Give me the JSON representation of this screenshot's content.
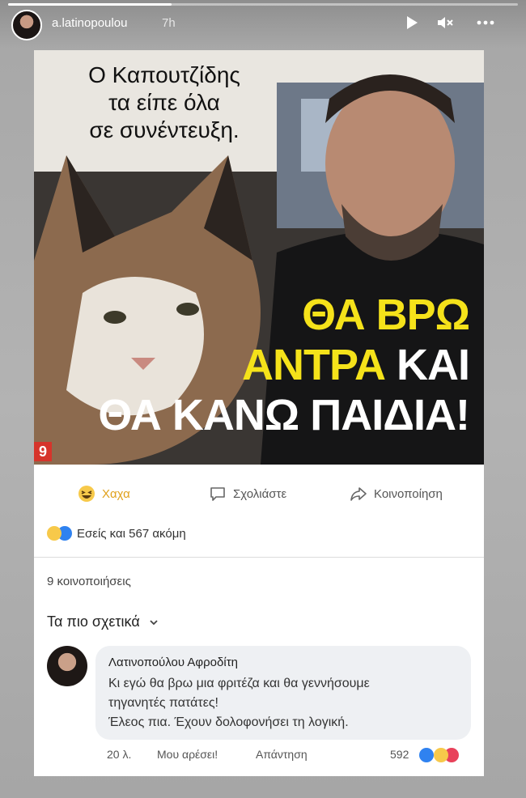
{
  "story": {
    "username": "a.latinopoulou",
    "time": "7h",
    "progress": 0.32,
    "icons": [
      "play-icon",
      "mute-icon",
      "more-icon"
    ]
  },
  "post": {
    "image_text": {
      "headline_small": [
        "Ο Καπουτζίδης",
        "τα είπε όλα",
        "σε συνέντευξη."
      ],
      "headline_big_line1": "ΘΑ ΒΡΩ",
      "headline_big_line2_yellow": "ΑΝΤΡΑ",
      "headline_big_line2_white": " ΚΑΙ",
      "headline_big_line3": "ΘΑ ΚΑΝΩ ΠΑΙΔΙΑ!",
      "logo": "9"
    },
    "actions": {
      "haha": "Χαχα",
      "comment": "Σχολιάστε",
      "share": "Κοινοποίηση"
    },
    "reactions_text": "Εσείς και 567 ακόμη",
    "shares": "9 κοινοποιήσεις",
    "sort": "Τα πιο σχετικά"
  },
  "comment": {
    "author": "Λατινοπούλου Αφροδίτη",
    "lines": [
      "Κι εγώ θα βρω μια φριτέζα και θα γεννήσουμε",
      "τηγανητές πατάτες!",
      "Έλεος πια. Έχουν δολοφονήσει τη λογική."
    ],
    "time": "20 λ.",
    "like": "Μου αρέσει!",
    "reply": "Απάντηση",
    "reaction_count": "592"
  },
  "colors": {
    "headline_yellow": "#f5e21a",
    "haha": "#e0a11b",
    "like_blue": "#2f82f0",
    "love_red": "#e8415a"
  }
}
